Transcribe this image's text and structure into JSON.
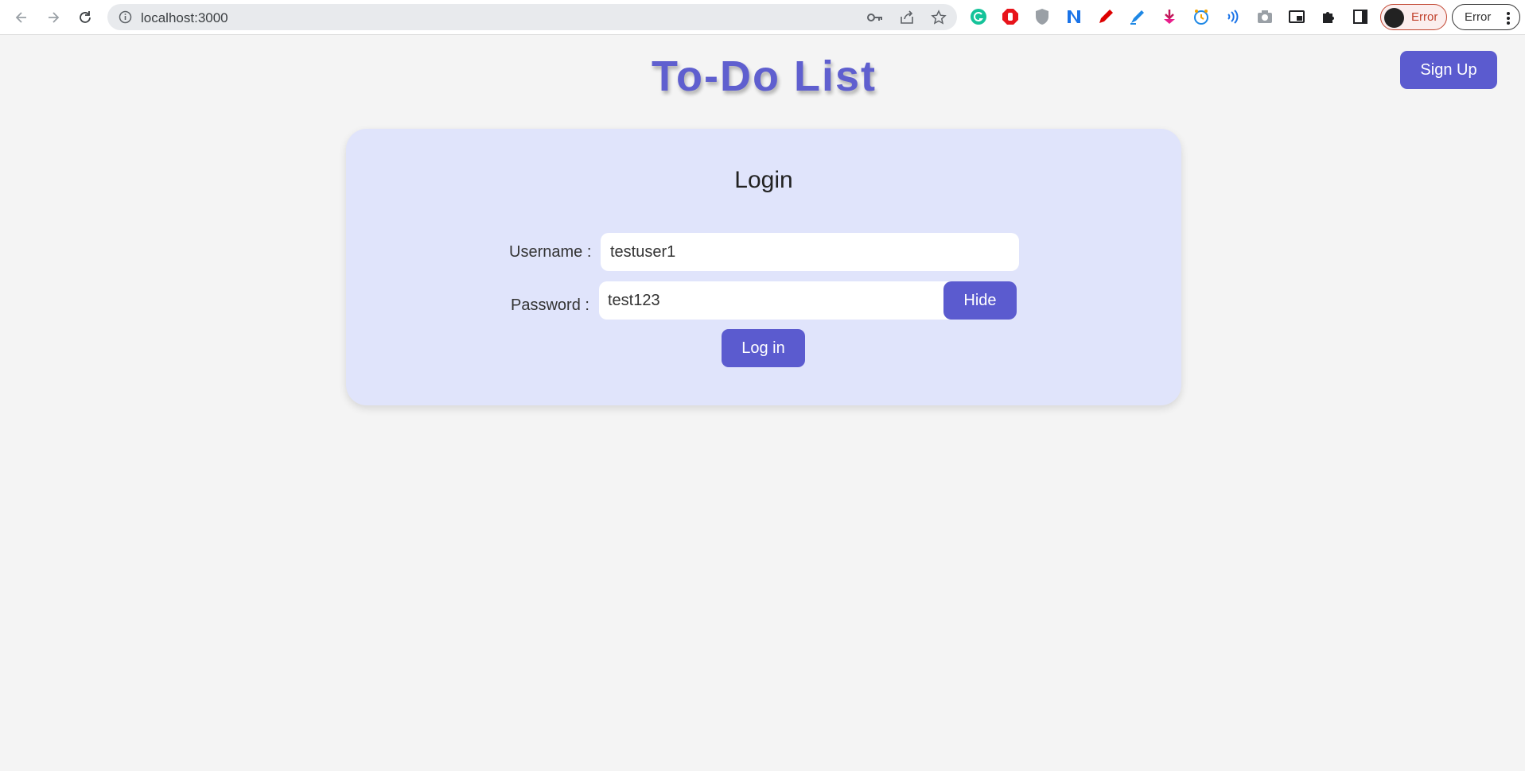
{
  "browser": {
    "url": "localhost:3000",
    "profile_status": "Error",
    "menu_status": "Error",
    "extensions": [
      "grammarly-icon",
      "adblock-icon",
      "shield-icon",
      "notion-icon",
      "pen-icon",
      "highlighter-icon",
      "gem-icon",
      "clock-icon",
      "audio-icon",
      "camera-icon",
      "pip-icon",
      "puzzle-icon",
      "sidepanel-icon"
    ]
  },
  "header": {
    "title": "To-Do List",
    "signup_label": "Sign Up"
  },
  "login": {
    "title": "Login",
    "username_label": "Username :",
    "username_value": "testuser1",
    "password_label": "Password :",
    "password_value": "test123",
    "hide_label": "Hide",
    "submit_label": "Log in"
  },
  "colors": {
    "accent": "#5b5bcf",
    "card": "#e0e4fb",
    "page": "#f4f4f4"
  }
}
